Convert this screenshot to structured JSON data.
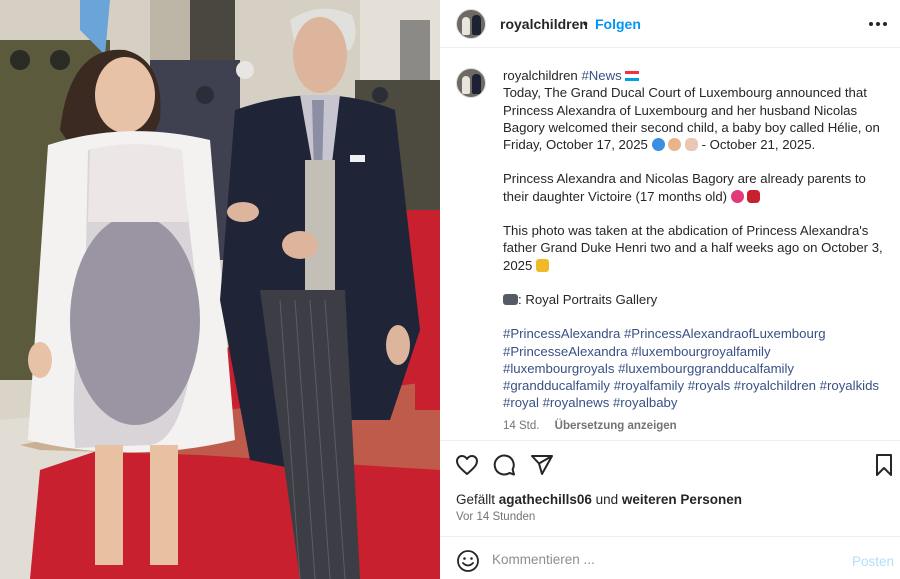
{
  "photo": {
    "alt": "Princess Alexandra and Nicolas Bagory walking on a red carpet"
  },
  "header": {
    "username": "royalchildren",
    "separator": "•",
    "follow_label": "Folgen",
    "more_icon": "more-horizontal-icon"
  },
  "caption": {
    "username": "royalchildren",
    "hashtag_news": "#News",
    "para1": "Today, The Grand Ducal Court of Luxembourg announced that Princess Alexandra of Luxembourg and her husband Nicolas Bagory welcomed their second child, a baby boy called Hélie, on Friday, October 17, 2025",
    "para1_tail": " - October 21, 2025.",
    "para2": "Princess Alexandra and Nicolas Bagory are already parents to their daughter Victoire (17 months old)",
    "para3": "This photo was taken at the abdication of Princess Alexandra's father Grand Duke Henri two and a half weeks ago on October 3, 2025",
    "para4": ": Royal Portraits Gallery",
    "hashtags": "#PrincessAlexandra #PrincessAlexandraofLuxembourg #PrincesseAlexandra #luxembourgroyalfamily #luxembourgroyals #luxembourggrandducalfamily #grandducalfamily #royalfamily #royals #royalchildren #royalkids #royal #royalnews #royalbaby",
    "age": "14 Std.",
    "translate_label": "Übersetzung anzeigen"
  },
  "actions": {
    "like_icon": "heart-icon",
    "comment_icon": "comment-icon",
    "share_icon": "send-icon",
    "save_icon": "bookmark-icon"
  },
  "likes": {
    "prefix": "Gefällt",
    "user": "agathechills06",
    "middle": "und",
    "suffix": "weiteren Personen"
  },
  "timestamp": "Vor 14 Stunden",
  "comment": {
    "placeholder": "Kommentieren ...",
    "post_label": "Posten"
  },
  "colors": {
    "accent": "#0095f6",
    "hashtag": "#385185",
    "post_disabled": "#b2dffc",
    "carpet": "#c8202f"
  }
}
